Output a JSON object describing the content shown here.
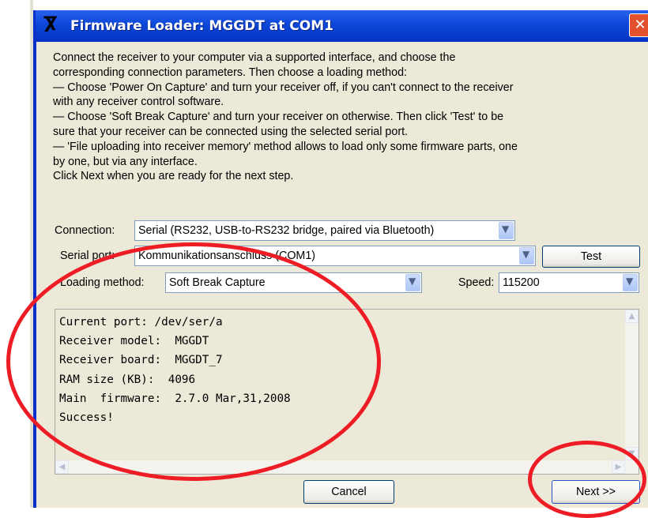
{
  "window": {
    "title": "Firmware Loader:  MGGDT at COM1",
    "icon": "receiver-logo-icon",
    "close_glyph": "✕",
    "colors": {
      "titlebar": "#0c47d8",
      "client": "#ece9d8",
      "close": "#e2502e",
      "annotation": "#ee1c24"
    }
  },
  "instructions": [
    "Connect the receiver to your computer via a supported interface, and choose the",
    "corresponding connection parameters. Then choose a loading method:",
    "  — Choose 'Power On Capture' and turn your receiver off, if you can't connect to the receiver",
    "with any receiver control software.",
    "  — Choose 'Soft Break Capture' and turn your receiver on otherwise. Then click 'Test' to be",
    "sure that your receiver can be connected using the selected serial port.",
    "  — 'File uploading into receiver memory' method allows to load only some firmware parts, one",
    "by one, but via any interface.",
    "Click Next when you are ready for the next step."
  ],
  "connection": {
    "label": "Connection:",
    "value": "Serial (RS232, USB-to-RS232 bridge, paired via Bluetooth)"
  },
  "serial_port": {
    "label": "Serial port:",
    "value": "Kommunikationsanschluss (COM1)"
  },
  "test_button": "Test",
  "loading_method": {
    "label": "Loading method:",
    "value": "Soft Break Capture"
  },
  "speed": {
    "label": "Speed:",
    "value": "115200"
  },
  "log_lines": [
    "Current port: /dev/ser/a",
    "Receiver model:  MGGDT",
    "Receiver board:  MGGDT_7",
    "RAM size (KB):  4096",
    "Main  firmware:  2.7.0 Mar,31,2008",
    "Success!"
  ],
  "cancel_button": "Cancel",
  "next_button": "Next >>"
}
